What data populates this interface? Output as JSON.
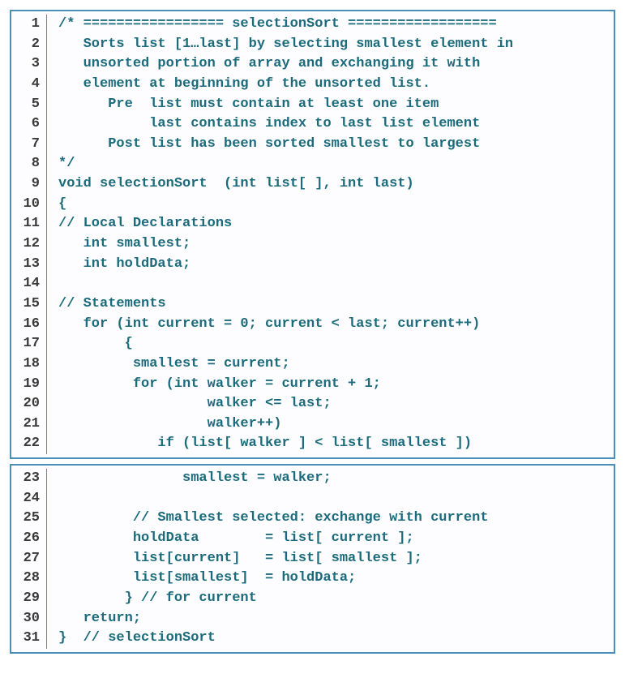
{
  "blocks": [
    {
      "lines": [
        {
          "n": 1,
          "t": "/* ================= selectionSort =================="
        },
        {
          "n": 2,
          "t": "   Sorts list [1…last] by selecting smallest element in"
        },
        {
          "n": 3,
          "t": "   unsorted portion of array and exchanging it with"
        },
        {
          "n": 4,
          "t": "   element at beginning of the unsorted list."
        },
        {
          "n": 5,
          "t": "      Pre  list must contain at least one item"
        },
        {
          "n": 6,
          "t": "           last contains index to last list element"
        },
        {
          "n": 7,
          "t": "      Post list has been sorted smallest to largest"
        },
        {
          "n": 8,
          "t": "*/"
        },
        {
          "n": 9,
          "t": "void selectionSort  (int list[ ], int last)"
        },
        {
          "n": 10,
          "t": "{"
        },
        {
          "n": 11,
          "t": "// Local Declarations"
        },
        {
          "n": 12,
          "t": "   int smallest;"
        },
        {
          "n": 13,
          "t": "   int holdData;"
        },
        {
          "n": 14,
          "t": ""
        },
        {
          "n": 15,
          "t": "// Statements"
        },
        {
          "n": 16,
          "t": "   for (int current = 0; current < last; current++)"
        },
        {
          "n": 17,
          "t": "        {"
        },
        {
          "n": 18,
          "t": "         smallest = current;"
        },
        {
          "n": 19,
          "t": "         for (int walker = current + 1;"
        },
        {
          "n": 20,
          "t": "                  walker <= last;"
        },
        {
          "n": 21,
          "t": "                  walker++)"
        },
        {
          "n": 22,
          "t": "            if (list[ walker ] < list[ smallest ])"
        }
      ]
    },
    {
      "lines": [
        {
          "n": 23,
          "t": "               smallest = walker;"
        },
        {
          "n": 24,
          "t": ""
        },
        {
          "n": 25,
          "t": "         // Smallest selected: exchange with current"
        },
        {
          "n": 26,
          "t": "         holdData        = list[ current ];"
        },
        {
          "n": 27,
          "t": "         list[current]   = list[ smallest ];"
        },
        {
          "n": 28,
          "t": "         list[smallest]  = holdData;"
        },
        {
          "n": 29,
          "t": "        } // for current"
        },
        {
          "n": 30,
          "t": "   return;"
        },
        {
          "n": 31,
          "t": "}  // selectionSort"
        }
      ]
    }
  ]
}
